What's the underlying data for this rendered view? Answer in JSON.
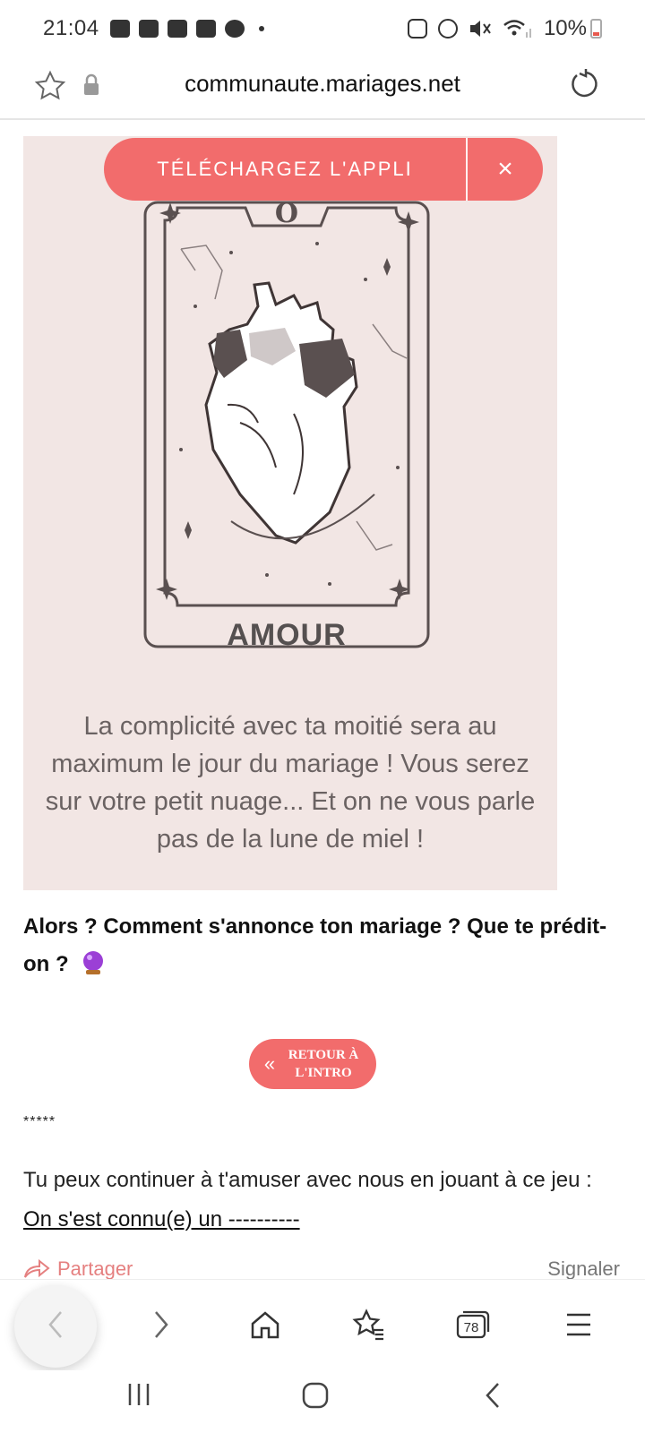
{
  "status_bar": {
    "time": "21:04",
    "battery_percent": "10%",
    "battery_level": 0.1
  },
  "browser": {
    "url": "communaute.mariages.net",
    "tab_count": "78"
  },
  "app_banner": {
    "label": "TÉLÉCHARGEZ L'APPLI",
    "close": "×"
  },
  "card": {
    "number": "O",
    "title": "AMOUR",
    "description": "La complicité avec ta moitié sera au maximum le jour du mariage ! Vous serez sur votre petit nuage... Et on ne vous parle pas de la lune de miel !"
  },
  "article": {
    "question": "Alors ? Comment s'annonce ton mariage ? Que te prédit-on ?",
    "retour_line1": "RETOUR À",
    "retour_line2": "L'INTRO",
    "separator": "*****",
    "continue_text": "Tu peux continuer à t'amuser avec nous en jouant à ce jeu : ",
    "continue_link": "On s'est connu(e) un ----------"
  },
  "actions": {
    "share": "Partager",
    "report": "Signaler"
  },
  "icons": {
    "bookmark": "star-icon",
    "lock": "lock-icon",
    "reload": "reload-icon",
    "crystal": "crystal-ball-icon",
    "accent": "#f26c6c"
  }
}
